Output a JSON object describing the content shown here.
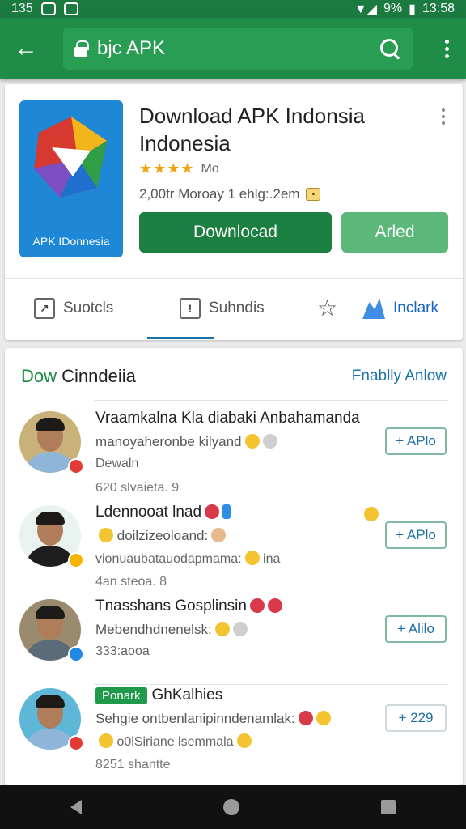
{
  "status_bar": {
    "left_text": "135",
    "battery": "9%",
    "time": "13:58"
  },
  "appbar": {
    "search_text": "bjc APK"
  },
  "app": {
    "title": "Download APK Indonsia Indonesia",
    "icon_label": "APK IDonnesia",
    "stars": "★★★★",
    "rating_text": "Mo",
    "meta": "2,00tr Moroay 1 ehlg:.2em",
    "download_button": "Downlocad",
    "added_button": "Arled"
  },
  "tabs": [
    {
      "label": "Suotcls",
      "icon": "edit-box-icon"
    },
    {
      "label": "Suhndis",
      "icon": "info-box-icon"
    },
    {
      "label": "",
      "icon": "star-outline-icon"
    },
    {
      "label": "Inclark",
      "icon": "chart-icon"
    }
  ],
  "section": {
    "title_green": "Dow",
    "title_rest": " Cinndeiia",
    "link": "Fnablly Anlow"
  },
  "items": [
    {
      "title": "Vraamkalna Kla diabaki Anbahamanda",
      "line2": "manoyaheronbe kilyand",
      "line3": "Dewaln",
      "line4": "620 slvaieta. 9",
      "button": "+ APlo",
      "badge_color": "#e53935",
      "body_color": "#8fb6d8"
    },
    {
      "title": "Ldennooat lnad",
      "line2": "doilzizeoloand:",
      "line3": "vionuaubatauodapmama:",
      "line3_suffix": "ina",
      "line4": "4an steoa. 8",
      "button": "+ APlo",
      "badge_color": "#f4b400",
      "body_color": "#1e1e1e"
    },
    {
      "title": "Tnasshans Gosplinsin",
      "line2": "Mebendhdnenelsk:",
      "line3": "333:aooa",
      "line4": "",
      "button": "+ Alilo",
      "badge_color": "#1e88e5",
      "body_color": "#5b6b7a"
    },
    {
      "pill": "Ponark",
      "title": "GhKalhies",
      "line2": "Sehgie ontbenlanipinndenamlak:",
      "line3": "o0lSiriane lsemmala",
      "line4": "8251 shantte",
      "button": "+ 229",
      "badge_color": "#e53935",
      "body_color": "#8fb6d8"
    }
  ]
}
